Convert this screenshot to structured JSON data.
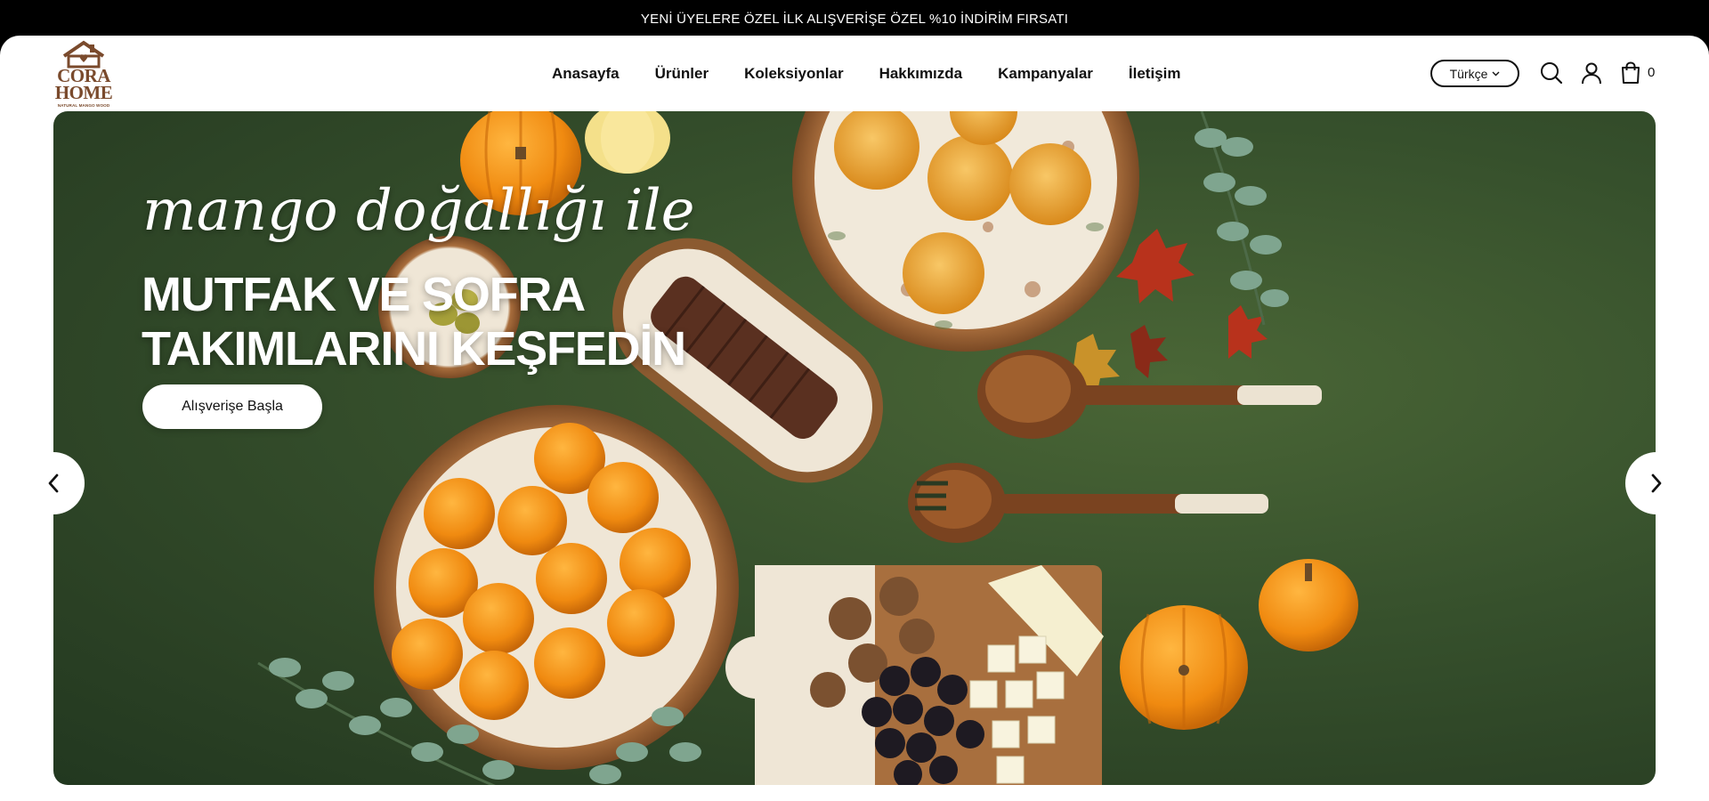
{
  "announcement": "YENİ ÜYELERE ÖZEL İLK ALIŞVERİŞE ÖZEL %10 İNDİRİM FIRSATI",
  "logo": {
    "line1": "CORA",
    "line2": "HOME",
    "tagline": "NATURAL MANGO WOOD"
  },
  "nav": {
    "items": [
      {
        "label": "Anasayfa"
      },
      {
        "label": "Ürünler"
      },
      {
        "label": "Koleksiyonlar"
      },
      {
        "label": "Hakkımızda"
      },
      {
        "label": "Kampanyalar"
      },
      {
        "label": "İletişim"
      }
    ]
  },
  "header": {
    "language": "Türkçe",
    "cart_count": "0",
    "icons": [
      "search-icon",
      "user-icon",
      "cart-icon"
    ]
  },
  "hero": {
    "script_line": "mango doğallığı ile",
    "headline_line1": "MUTFAK VE SOFRA",
    "headline_line2": "TAKIMLARINI KEŞFEDİN",
    "cta": "Alışverişe Başla",
    "prev_icon": "chevron-left-icon",
    "next_icon": "chevron-right-icon"
  },
  "colors": {
    "announcement_bg": "#000000",
    "brand_brown": "#7a4a2c",
    "hero_green": "#36502c",
    "orange": "#f2961a"
  }
}
